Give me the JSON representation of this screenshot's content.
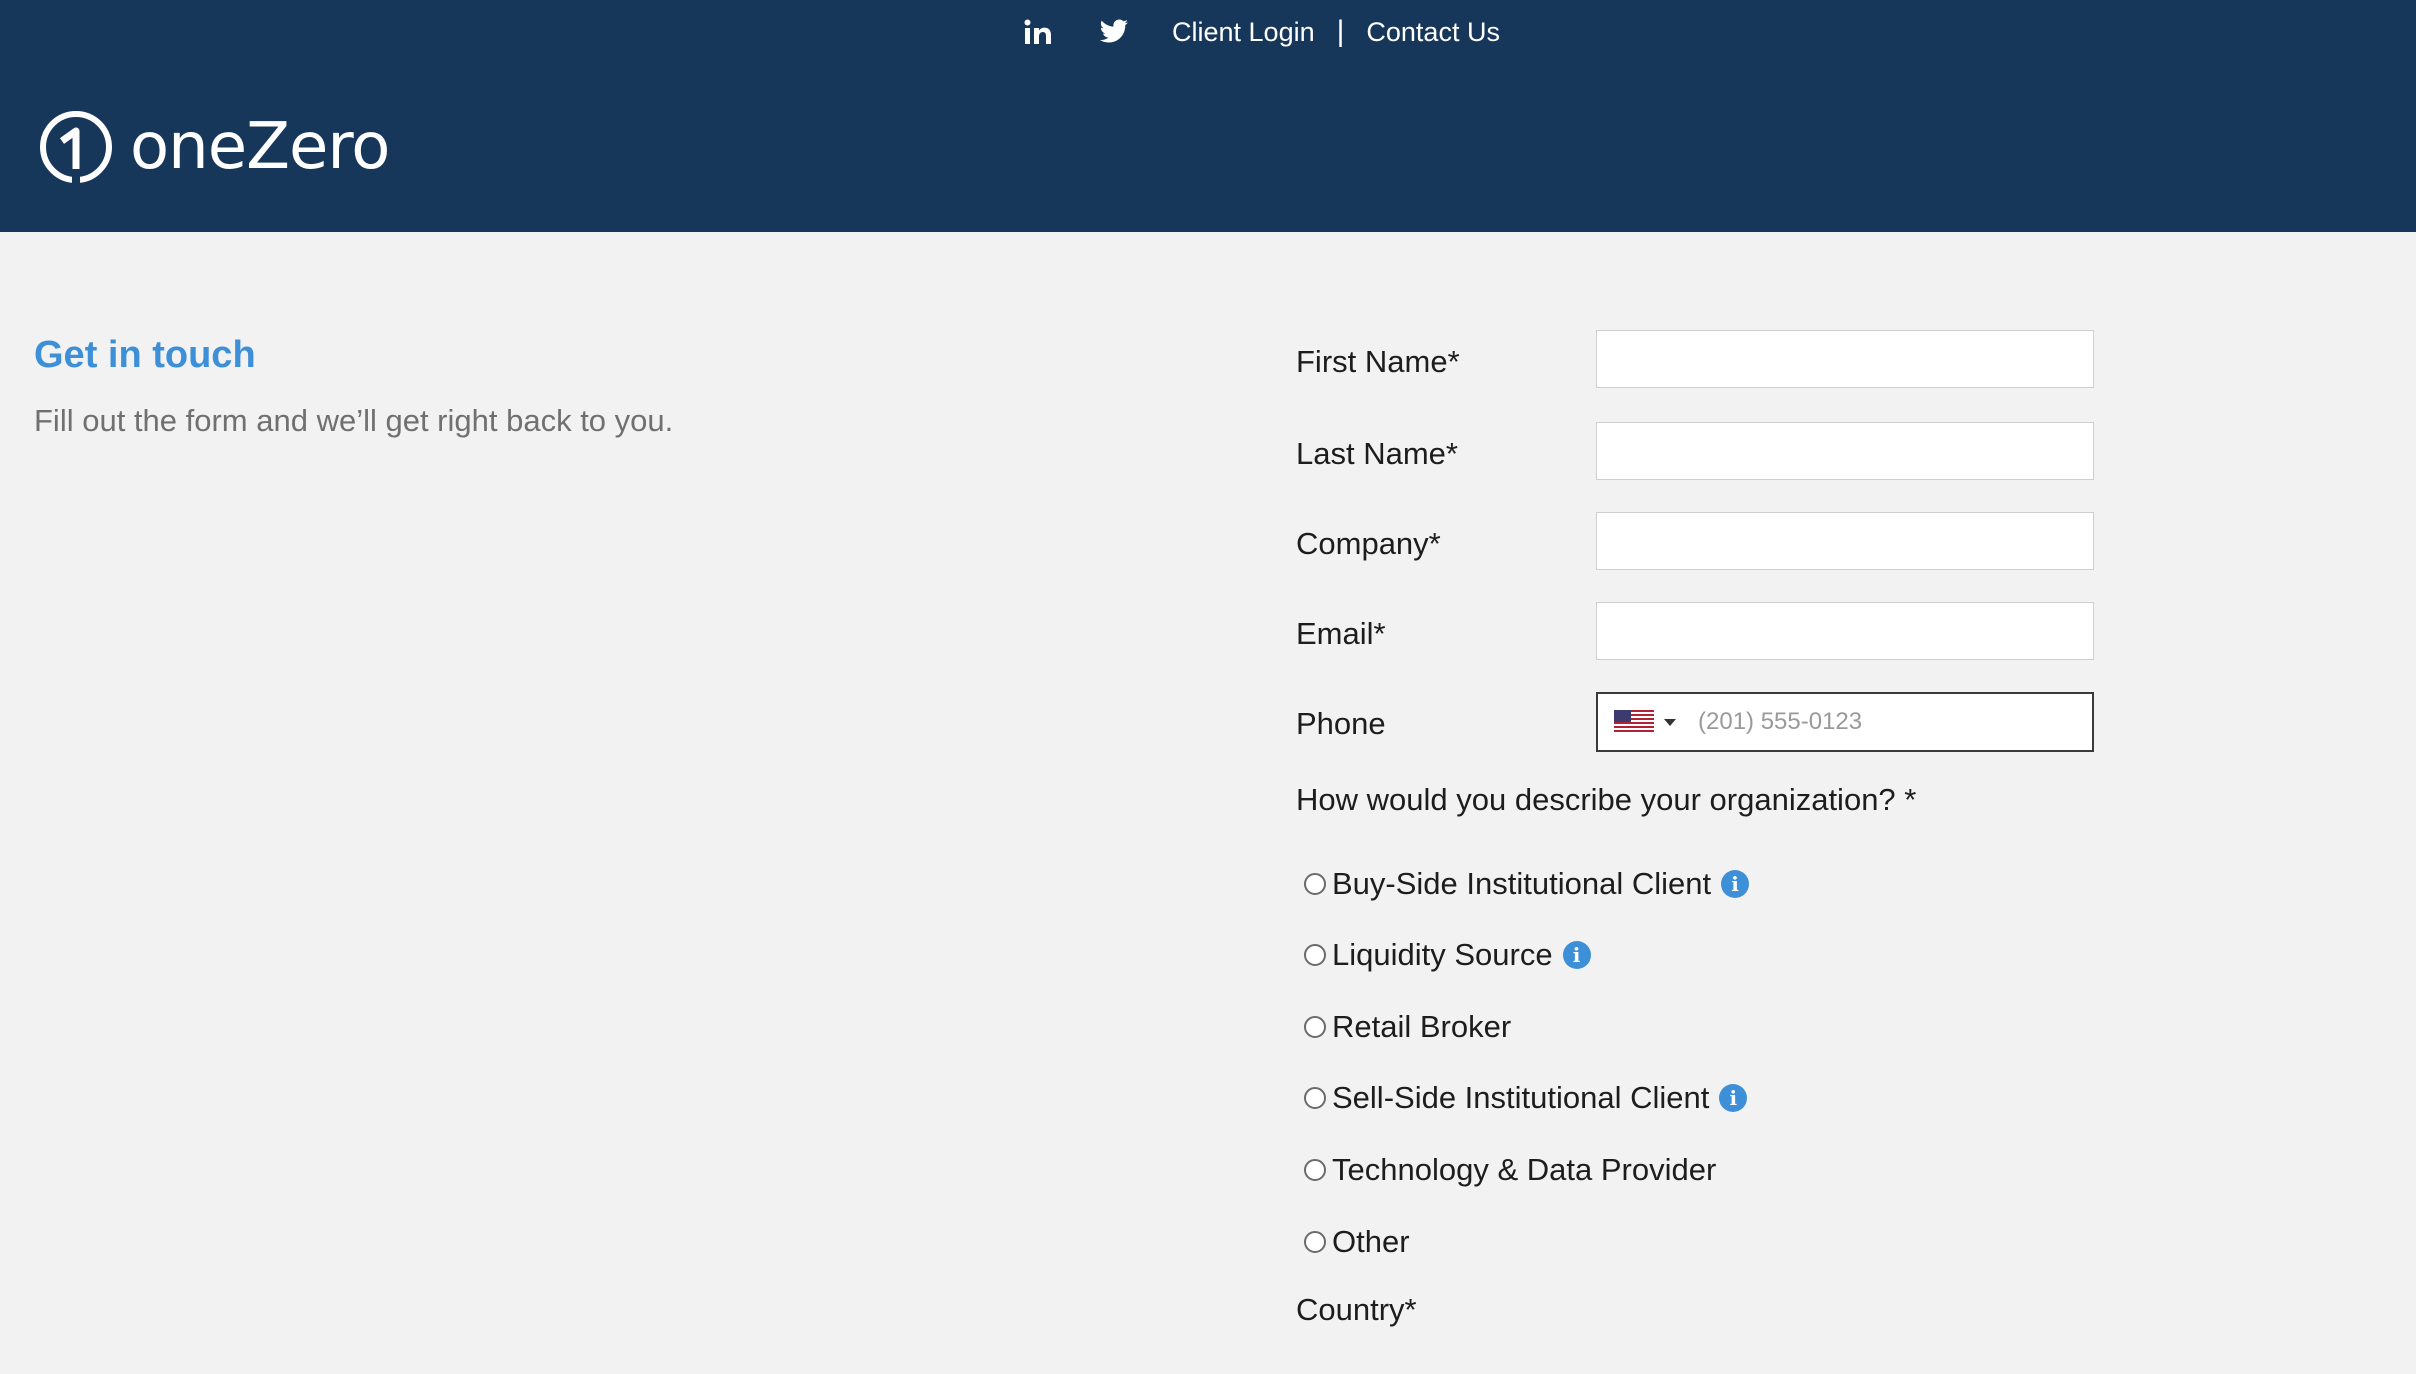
{
  "header": {
    "nav": {
      "client_login": "Client Login",
      "separator": "|",
      "contact_us": "Contact Us"
    },
    "logo_text": "oneZero",
    "colors": {
      "background": "#17375a",
      "accent": "#3d8fd8"
    }
  },
  "intro": {
    "title": "Get in touch",
    "subtitle": "Fill out the form and we’ll get right back to you."
  },
  "form": {
    "first_name_label": "First Name*",
    "last_name_label": "Last Name*",
    "company_label": "Company*",
    "email_label": "Email*",
    "phone_label": "Phone",
    "phone_placeholder": "(201) 555-0123",
    "org_question": "How would you describe your organization? *",
    "org_options": [
      {
        "label": "Buy-Side Institutional Client",
        "info_icon": true
      },
      {
        "label": "Liquidity Source",
        "info_icon": true
      },
      {
        "label": "Retail Broker",
        "info_icon": false
      },
      {
        "label": "Sell-Side Institutional Client",
        "info_icon": true
      },
      {
        "label": "Technology & Data Provider",
        "info_icon": false
      },
      {
        "label": "Other",
        "info_icon": false
      }
    ],
    "country_label": "Country*"
  }
}
